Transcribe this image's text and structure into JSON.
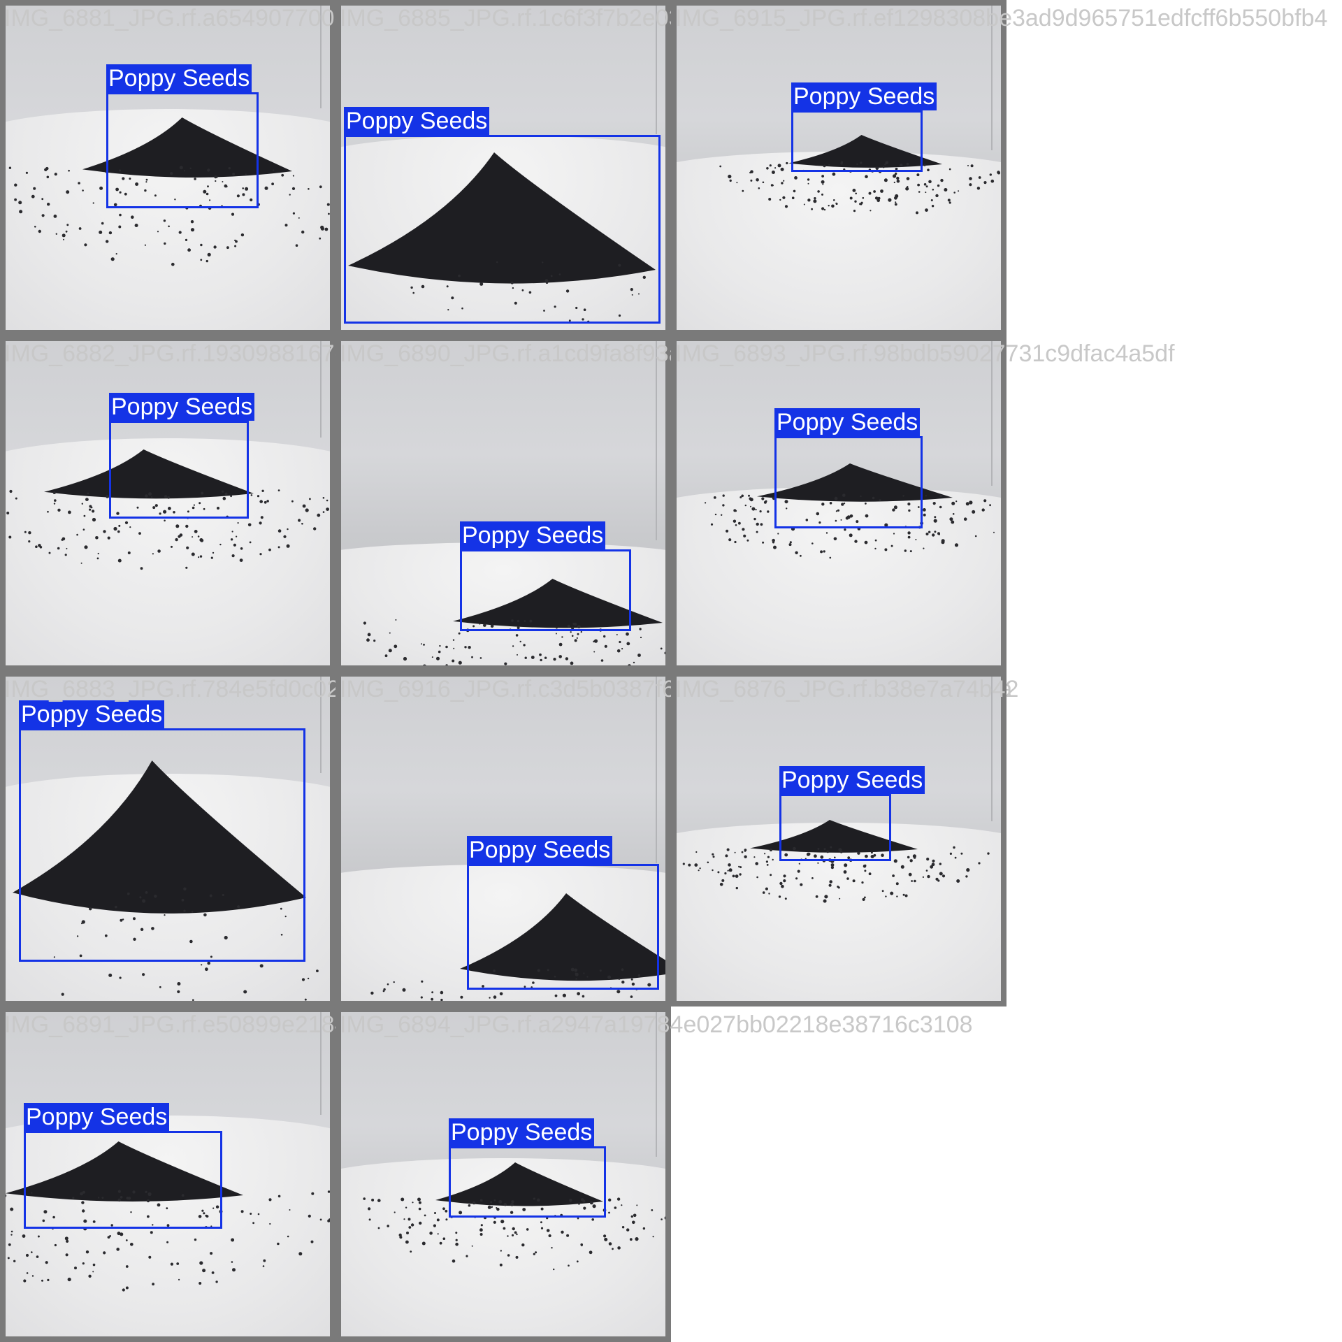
{
  "label_text": "Poppy Seeds",
  "colors": {
    "box": "#1433e6",
    "tile_border": "#7a7a7a",
    "filename": "#c8c8c8"
  },
  "tiles": [
    {
      "filename": "IMG_6881_JPG.rf.a654907700c689ff7f3cbd5f59111d25"
    },
    {
      "filename": "IMG_6885_JPG.rf.1c6f3f7b2e03ae5b7ad7cc7ad"
    },
    {
      "filename": "IMG_6915_JPG.rf.ef1298308be3ad9d965751edfcff6b550bfb4"
    },
    {
      "filename": "IMG_6882_JPG.rf.1930988167c593026b3b4584b5f29a"
    },
    {
      "filename": "IMG_6890_JPG.rf.a1cd9fa8f93a5f764e"
    },
    {
      "filename": "IMG_6893_JPG.rf.98bdb59027731c9dfac4a5df"
    },
    {
      "filename": "IMG_6883_JPG.rf.784e5fd0c02ca6918c36e5ba96fdb19c"
    },
    {
      "filename": "IMG_6916_JPG.rf.c3d5b0387f6f2374b4237a3e266489106797a"
    },
    {
      "filename": "IMG_6876_JPG.rf.b38e7a74b42"
    },
    {
      "filename": "IMG_6891_JPG.rf.e50899e21841a"
    },
    {
      "filename": "IMG_6894_JPG.rf.a2947a19784e027bb02218e38716c3108"
    }
  ]
}
